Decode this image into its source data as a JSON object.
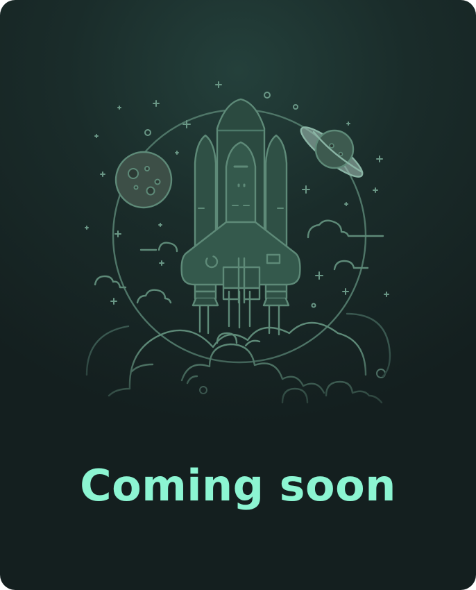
{
  "card": {
    "title": "Coming soon",
    "title_color": "#8cf5d2"
  },
  "illustration": {
    "subject": "rocket-launch",
    "line_color": "#5e8a78",
    "fill_color": "#2b4a40"
  }
}
